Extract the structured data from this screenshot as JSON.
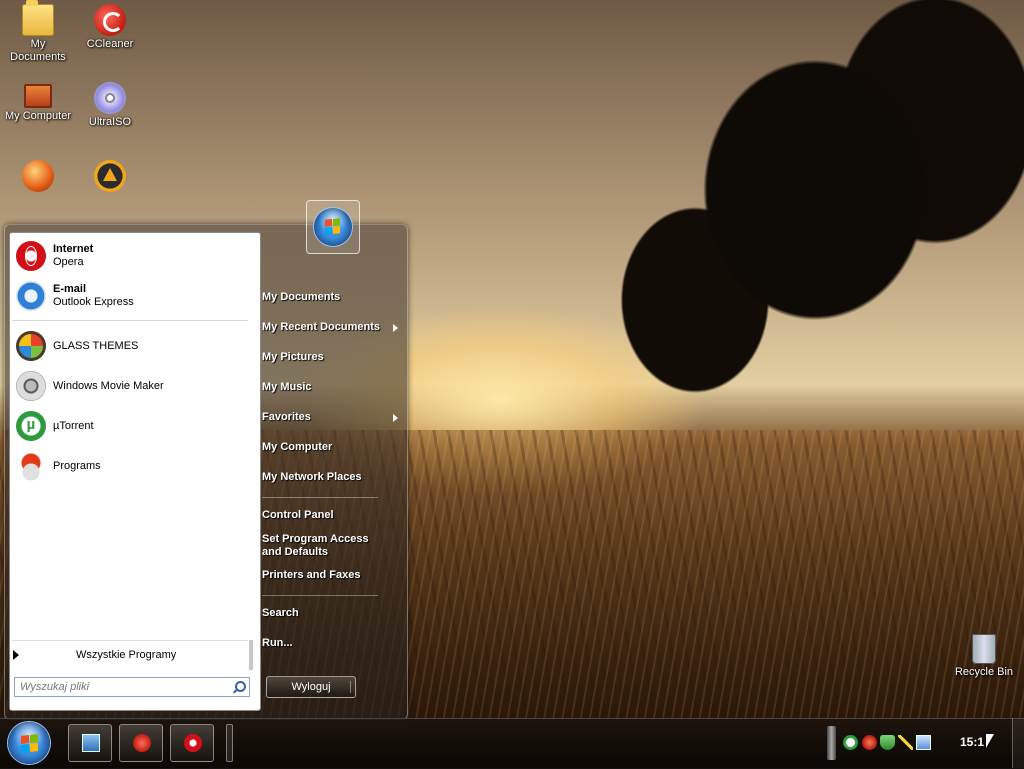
{
  "desktop": {
    "icons": [
      {
        "label": "My\nDocuments",
        "icon": "folder-icon"
      },
      {
        "label": "CCleaner",
        "icon": "ccleaner-icon"
      },
      {
        "label": "My Computer",
        "icon": "computer-icon"
      },
      {
        "label": "UltraISO",
        "icon": "disc-icon"
      },
      {
        "label": "",
        "icon": "globe-icon"
      },
      {
        "label": "",
        "icon": "aimp-icon"
      },
      {
        "label": "Recycle Bin",
        "icon": "recycle-bin-icon"
      }
    ]
  },
  "start_menu": {
    "pinned": [
      {
        "title": "Internet",
        "subtitle": "Opera",
        "icon": "opera-icon"
      },
      {
        "title": "E-mail",
        "subtitle": "Outlook Express",
        "icon": "outlook-express-icon"
      }
    ],
    "recent": [
      {
        "label": "GLASS THEMES",
        "icon": "glass-themes-icon"
      },
      {
        "label": "Windows Movie Maker",
        "icon": "movie-maker-icon"
      },
      {
        "label": "µTorrent",
        "icon": "utorrent-icon"
      },
      {
        "label": "Programs",
        "icon": "programs-icon"
      }
    ],
    "all_programs_label": "Wszystkie Programy",
    "search_placeholder": "Wyszukaj pliki",
    "right_items": [
      {
        "label": "My Documents",
        "submenu": false
      },
      {
        "label": "My Recent Documents",
        "submenu": true
      },
      {
        "label": "My Pictures",
        "submenu": false
      },
      {
        "label": "My Music",
        "submenu": false
      },
      {
        "label": "Favorites",
        "submenu": true
      },
      {
        "label": "My Computer",
        "submenu": false
      },
      {
        "label": "My Network Places",
        "submenu": false
      },
      {
        "label": "Control Panel",
        "submenu": false
      },
      {
        "label": "Set Program Access and Defaults",
        "submenu": false
      },
      {
        "label": "Printers and Faxes",
        "submenu": false
      },
      {
        "label": "Search",
        "submenu": false
      },
      {
        "label": "Run...",
        "submenu": false
      }
    ],
    "logoff_label": "Wyloguj"
  },
  "taskbar": {
    "buttons": [
      {
        "icon": "show-desktop-icon"
      },
      {
        "icon": "ccleaner-icon"
      },
      {
        "icon": "opera-icon"
      }
    ],
    "tray_icons": [
      "utorrent-tray-icon",
      "ccleaner-tray-icon",
      "security-shield-icon",
      "wand-icon",
      "network-icon"
    ],
    "clock": "15:1"
  },
  "colors": {
    "accent": "#2f7fd6",
    "menu_text": "#ffffff",
    "taskbar": "#0f0b07"
  }
}
